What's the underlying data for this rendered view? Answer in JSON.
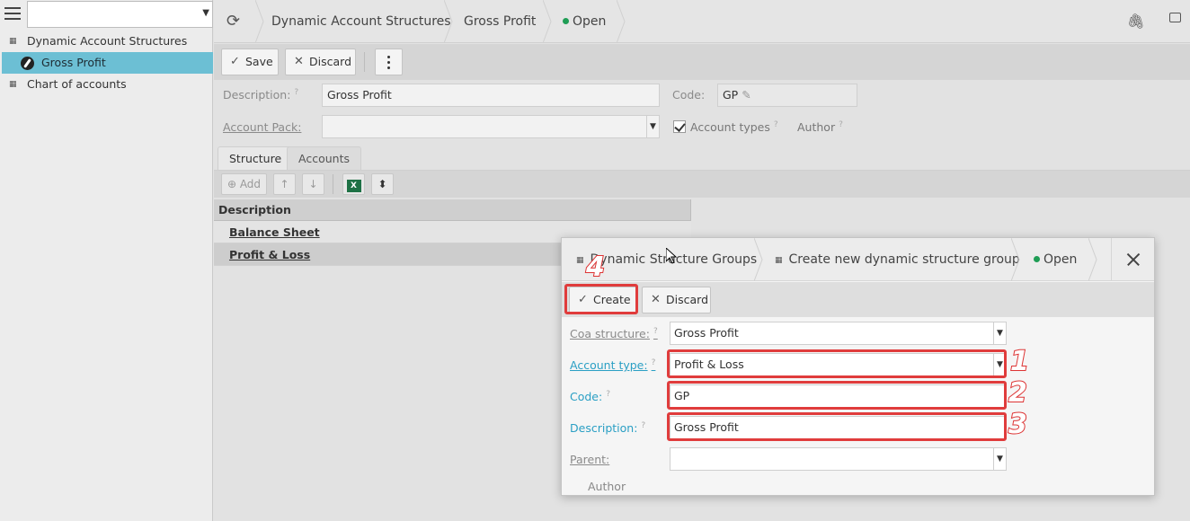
{
  "sidebar": {
    "select_value": "",
    "items": [
      {
        "label": "Dynamic Account Structures"
      },
      {
        "label": "Gross Profit"
      },
      {
        "label": "Chart of accounts"
      }
    ]
  },
  "header": {
    "breadcrumbs": [
      "Dynamic Account Structures",
      "Gross Profit"
    ],
    "status": "Open"
  },
  "toolbar": {
    "save_label": "Save",
    "discard_label": "Discard"
  },
  "form": {
    "description_label": "Description:",
    "description_value": "Gross Profit",
    "code_label": "Code:",
    "code_value": "GP",
    "account_pack_label": "Account Pack:",
    "account_pack_value": "",
    "account_types_label": "Account types",
    "account_types_checked": true,
    "author_label": "Author",
    "hint_mark": "?"
  },
  "tabs": [
    {
      "label": "Structure",
      "active": true
    },
    {
      "label": "Accounts",
      "active": false
    }
  ],
  "grid_toolbar": {
    "add_label": "Add"
  },
  "grid": {
    "columns": [
      "Description"
    ],
    "rows": [
      "Balance Sheet",
      "Profit & Loss"
    ]
  },
  "dialog": {
    "breadcrumbs": [
      "Dynamic Structure Groups",
      "Create new dynamic structure group"
    ],
    "status": "Open",
    "create_label": "Create",
    "discard_label": "Discard",
    "fields": {
      "coa_structure_label": "Coa structure:",
      "coa_structure_value": "Gross Profit",
      "account_type_label": "Account type:",
      "account_type_value": "Profit & Loss",
      "code_label": "Code:",
      "code_value": "GP",
      "description_label": "Description:",
      "description_value": "Gross Profit",
      "parent_label": "Parent:",
      "parent_value": "",
      "author_label": "Author"
    }
  },
  "annotations": [
    "1",
    "2",
    "3",
    "4"
  ],
  "colors": {
    "selection": "#6cbfd4",
    "required_label": "#2a9fc4",
    "status_dot": "#1f9d55",
    "annotation": "#e03c3c"
  }
}
